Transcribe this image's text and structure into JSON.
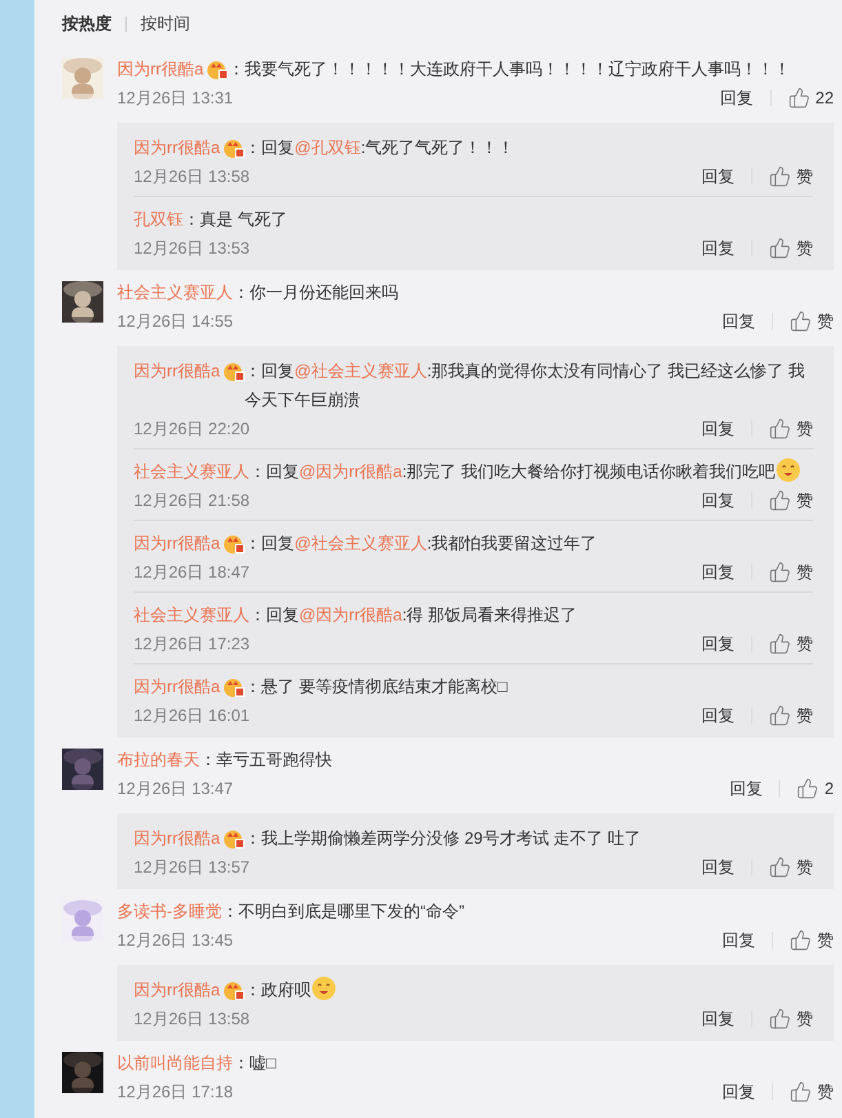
{
  "sort_tabs": [
    {
      "label": "按热度",
      "selected": true
    },
    {
      "label": "按时间",
      "selected": false
    }
  ],
  "comments": [
    {
      "avatar": {
        "kind": "picture"
      },
      "user": "因为rr很酷a",
      "badge": true,
      "text": "：我要气死了！！！！！大连政府干人事吗！！！！辽宁政府干人事吗！！！",
      "time": "12月26日 13:31",
      "reply_label": "回复",
      "like_label": "22",
      "replies": [
        {
          "user": "因为rr很酷a",
          "badge": true,
          "text": "：回复",
          "mention": "@孔双钰",
          "after": ":气死了气死了！！！",
          "time": "12月26日 13:58",
          "reply_label": "回复",
          "like_label": "赞"
        },
        {
          "user": "孔双钰",
          "badge": false,
          "text": "：真是 气死了",
          "time": "12月26日 13:53",
          "reply_label": "回复",
          "like_label": "赞"
        }
      ]
    },
    {
      "avatar": {
        "kind": "picture"
      },
      "user": "社会主义赛亚人",
      "badge": false,
      "text": "：你一月份还能回来吗",
      "time": "12月26日 14:55",
      "reply_label": "回复",
      "like_label": "赞",
      "replies": [
        {
          "user": "因为rr很酷a",
          "badge": true,
          "text": "：回复",
          "mention": "@社会主义赛亚人",
          "after": ":那我真的觉得你太没有同情心了 我已经这么惨了 我今天下午巨崩溃",
          "time": "12月26日 22:20",
          "reply_label": "回复",
          "like_label": "赞"
        },
        {
          "user": "社会主义赛亚人",
          "badge": false,
          "text": "：回复",
          "mention": "@因为rr很酷a",
          "after": ":那完了 我们吃大餐给你打视频电话你瞅着我们吃吧",
          "emoji": true,
          "time": "12月26日 21:58",
          "reply_label": "回复",
          "like_label": "赞"
        },
        {
          "user": "因为rr很酷a",
          "badge": true,
          "text": "：回复",
          "mention": "@社会主义赛亚人",
          "after": ":我都怕我要留这过年了",
          "time": "12月26日 18:47",
          "reply_label": "回复",
          "like_label": "赞"
        },
        {
          "user": "社会主义赛亚人",
          "badge": false,
          "text": "：回复",
          "mention": "@因为rr很酷a",
          "after": ":得 那饭局看来得推迟了",
          "time": "12月26日 17:23",
          "reply_label": "回复",
          "like_label": "赞"
        },
        {
          "user": "因为rr很酷a",
          "badge": true,
          "text": "：悬了 要等疫情彻底结束才能离校□",
          "time": "12月26日 16:01",
          "reply_label": "回复",
          "like_label": "赞"
        }
      ]
    },
    {
      "avatar": {
        "kind": "picture"
      },
      "user": "布拉的春天",
      "badge": false,
      "text": "：幸亏五哥跑得快",
      "time": "12月26日 13:47",
      "reply_label": "回复",
      "like_label": "2",
      "replies": [
        {
          "user": "因为rr很酷a",
          "badge": true,
          "text": "：我上学期偷懒差两学分没修 29号才考试 走不了 吐了",
          "time": "12月26日 13:57",
          "reply_label": "回复",
          "like_label": "赞"
        }
      ]
    },
    {
      "avatar": {
        "kind": "picture"
      },
      "user": "多读书-多睡觉",
      "badge": false,
      "text": "：不明白到底是哪里下发的“命令”",
      "time": "12月26日 13:45",
      "reply_label": "回复",
      "like_label": "赞",
      "replies": [
        {
          "user": "因为rr很酷a",
          "badge": true,
          "text": "：政府呗",
          "emoji": true,
          "time": "12月26日 13:58",
          "reply_label": "回复",
          "like_label": "赞"
        }
      ]
    },
    {
      "avatar": {
        "kind": "picture"
      },
      "user": "以前叫尚能自持",
      "badge": false,
      "text": "：嘘□",
      "time": "12月26日 17:18",
      "reply_label": "回复",
      "like_label": "赞"
    }
  ]
}
